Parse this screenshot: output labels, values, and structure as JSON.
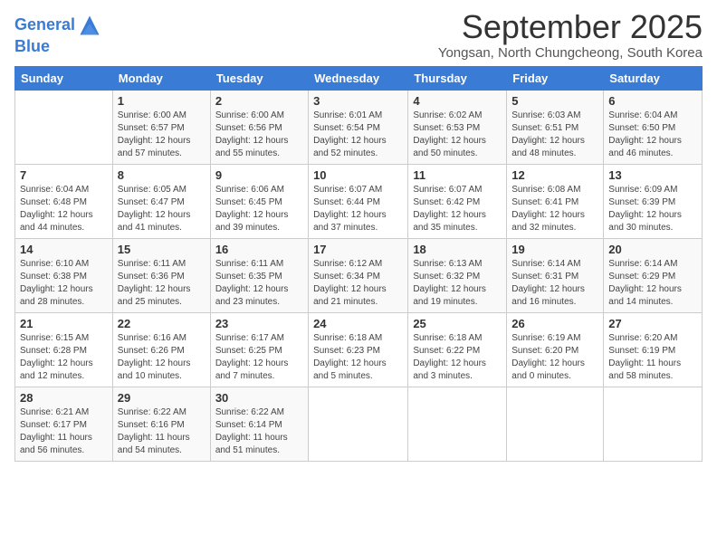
{
  "logo": {
    "line1": "General",
    "line2": "Blue"
  },
  "title": "September 2025",
  "subtitle": "Yongsan, North Chungcheong, South Korea",
  "days_of_week": [
    "Sunday",
    "Monday",
    "Tuesday",
    "Wednesday",
    "Thursday",
    "Friday",
    "Saturday"
  ],
  "weeks": [
    [
      {
        "day": "",
        "info": ""
      },
      {
        "day": "1",
        "info": "Sunrise: 6:00 AM\nSunset: 6:57 PM\nDaylight: 12 hours\nand 57 minutes."
      },
      {
        "day": "2",
        "info": "Sunrise: 6:00 AM\nSunset: 6:56 PM\nDaylight: 12 hours\nand 55 minutes."
      },
      {
        "day": "3",
        "info": "Sunrise: 6:01 AM\nSunset: 6:54 PM\nDaylight: 12 hours\nand 52 minutes."
      },
      {
        "day": "4",
        "info": "Sunrise: 6:02 AM\nSunset: 6:53 PM\nDaylight: 12 hours\nand 50 minutes."
      },
      {
        "day": "5",
        "info": "Sunrise: 6:03 AM\nSunset: 6:51 PM\nDaylight: 12 hours\nand 48 minutes."
      },
      {
        "day": "6",
        "info": "Sunrise: 6:04 AM\nSunset: 6:50 PM\nDaylight: 12 hours\nand 46 minutes."
      }
    ],
    [
      {
        "day": "7",
        "info": "Sunrise: 6:04 AM\nSunset: 6:48 PM\nDaylight: 12 hours\nand 44 minutes."
      },
      {
        "day": "8",
        "info": "Sunrise: 6:05 AM\nSunset: 6:47 PM\nDaylight: 12 hours\nand 41 minutes."
      },
      {
        "day": "9",
        "info": "Sunrise: 6:06 AM\nSunset: 6:45 PM\nDaylight: 12 hours\nand 39 minutes."
      },
      {
        "day": "10",
        "info": "Sunrise: 6:07 AM\nSunset: 6:44 PM\nDaylight: 12 hours\nand 37 minutes."
      },
      {
        "day": "11",
        "info": "Sunrise: 6:07 AM\nSunset: 6:42 PM\nDaylight: 12 hours\nand 35 minutes."
      },
      {
        "day": "12",
        "info": "Sunrise: 6:08 AM\nSunset: 6:41 PM\nDaylight: 12 hours\nand 32 minutes."
      },
      {
        "day": "13",
        "info": "Sunrise: 6:09 AM\nSunset: 6:39 PM\nDaylight: 12 hours\nand 30 minutes."
      }
    ],
    [
      {
        "day": "14",
        "info": "Sunrise: 6:10 AM\nSunset: 6:38 PM\nDaylight: 12 hours\nand 28 minutes."
      },
      {
        "day": "15",
        "info": "Sunrise: 6:11 AM\nSunset: 6:36 PM\nDaylight: 12 hours\nand 25 minutes."
      },
      {
        "day": "16",
        "info": "Sunrise: 6:11 AM\nSunset: 6:35 PM\nDaylight: 12 hours\nand 23 minutes."
      },
      {
        "day": "17",
        "info": "Sunrise: 6:12 AM\nSunset: 6:34 PM\nDaylight: 12 hours\nand 21 minutes."
      },
      {
        "day": "18",
        "info": "Sunrise: 6:13 AM\nSunset: 6:32 PM\nDaylight: 12 hours\nand 19 minutes."
      },
      {
        "day": "19",
        "info": "Sunrise: 6:14 AM\nSunset: 6:31 PM\nDaylight: 12 hours\nand 16 minutes."
      },
      {
        "day": "20",
        "info": "Sunrise: 6:14 AM\nSunset: 6:29 PM\nDaylight: 12 hours\nand 14 minutes."
      }
    ],
    [
      {
        "day": "21",
        "info": "Sunrise: 6:15 AM\nSunset: 6:28 PM\nDaylight: 12 hours\nand 12 minutes."
      },
      {
        "day": "22",
        "info": "Sunrise: 6:16 AM\nSunset: 6:26 PM\nDaylight: 12 hours\nand 10 minutes."
      },
      {
        "day": "23",
        "info": "Sunrise: 6:17 AM\nSunset: 6:25 PM\nDaylight: 12 hours\nand 7 minutes."
      },
      {
        "day": "24",
        "info": "Sunrise: 6:18 AM\nSunset: 6:23 PM\nDaylight: 12 hours\nand 5 minutes."
      },
      {
        "day": "25",
        "info": "Sunrise: 6:18 AM\nSunset: 6:22 PM\nDaylight: 12 hours\nand 3 minutes."
      },
      {
        "day": "26",
        "info": "Sunrise: 6:19 AM\nSunset: 6:20 PM\nDaylight: 12 hours\nand 0 minutes."
      },
      {
        "day": "27",
        "info": "Sunrise: 6:20 AM\nSunset: 6:19 PM\nDaylight: 11 hours\nand 58 minutes."
      }
    ],
    [
      {
        "day": "28",
        "info": "Sunrise: 6:21 AM\nSunset: 6:17 PM\nDaylight: 11 hours\nand 56 minutes."
      },
      {
        "day": "29",
        "info": "Sunrise: 6:22 AM\nSunset: 6:16 PM\nDaylight: 11 hours\nand 54 minutes."
      },
      {
        "day": "30",
        "info": "Sunrise: 6:22 AM\nSunset: 6:14 PM\nDaylight: 11 hours\nand 51 minutes."
      },
      {
        "day": "",
        "info": ""
      },
      {
        "day": "",
        "info": ""
      },
      {
        "day": "",
        "info": ""
      },
      {
        "day": "",
        "info": ""
      }
    ]
  ]
}
